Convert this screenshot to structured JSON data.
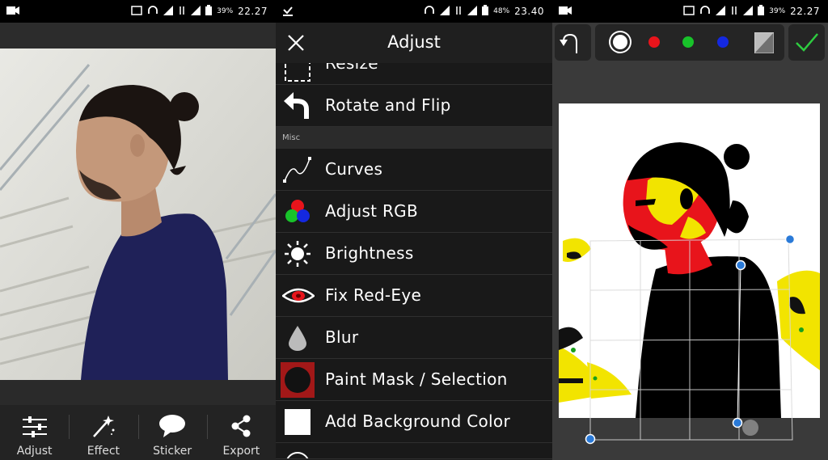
{
  "screen1": {
    "status": {
      "battery_pct": "39%",
      "time": "22.27"
    },
    "bottom_bar": [
      {
        "label": "Adjust",
        "icon": "sliders-icon"
      },
      {
        "label": "Effect",
        "icon": "magic-wand-icon"
      },
      {
        "label": "Sticker",
        "icon": "speech-bubble-icon"
      },
      {
        "label": "Export",
        "icon": "share-icon"
      }
    ]
  },
  "screen2": {
    "status": {
      "battery_pct": "48%",
      "time": "23.40"
    },
    "title": "Adjust",
    "items_top": [
      {
        "label": "Resize",
        "icon": "resize-icon"
      },
      {
        "label": "Rotate and Flip",
        "icon": "rotate-arrow-icon"
      }
    ],
    "section_label": "Misc",
    "items": [
      {
        "label": "Curves",
        "icon": "curve-icon"
      },
      {
        "label": "Adjust RGB",
        "icon": "rgb-circles-icon"
      },
      {
        "label": "Brightness",
        "icon": "sun-icon"
      },
      {
        "label": "Fix Red-Eye",
        "icon": "red-eye-icon"
      },
      {
        "label": "Blur",
        "icon": "droplet-icon"
      },
      {
        "label": "Paint Mask / Selection",
        "icon": "mask-icon"
      },
      {
        "label": "Add Background Color",
        "icon": "white-square-icon"
      }
    ]
  },
  "screen3": {
    "status": {
      "battery_pct": "39%",
      "time": "22.27"
    },
    "colors": [
      "#ffffff",
      "#e8141b",
      "#18c22a",
      "#1428e0"
    ]
  }
}
